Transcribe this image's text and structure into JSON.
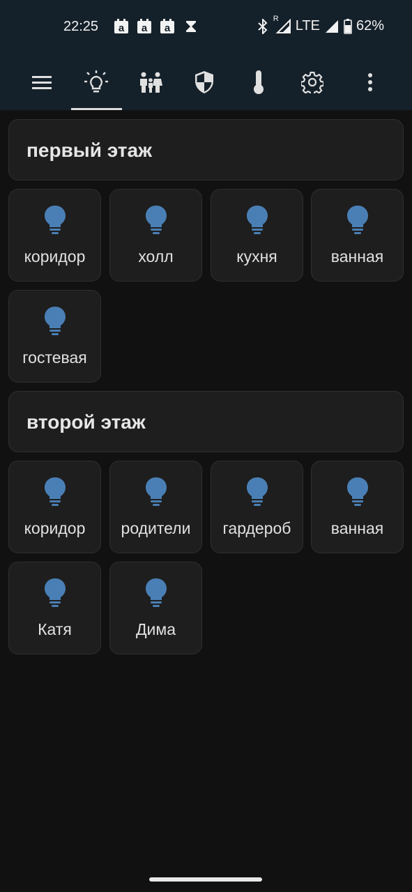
{
  "status_bar": {
    "time": "22:25",
    "notification_icons": [
      "amazon-icon",
      "amazon-icon",
      "amazon-icon",
      "hourglass-icon"
    ],
    "roaming_indicator": "R",
    "network": "LTE",
    "battery": "62%"
  },
  "tabs": [
    {
      "icon": "menu-icon"
    },
    {
      "icon": "lightbulb-icon",
      "selected": true
    },
    {
      "icon": "family-icon"
    },
    {
      "icon": "security-shield-icon"
    },
    {
      "icon": "thermometer-icon"
    },
    {
      "icon": "gear-icon"
    },
    {
      "icon": "more-vert-icon"
    }
  ],
  "colors": {
    "accent": "#4a7fb5",
    "background": "#111111",
    "card": "#1e1e1e",
    "app_bar": "#15212a"
  },
  "floors": [
    {
      "title": "первый этаж",
      "rooms": [
        {
          "label": "коридор",
          "icon": "lightbulb-icon"
        },
        {
          "label": "холл",
          "icon": "lightbulb-icon"
        },
        {
          "label": "кухня",
          "icon": "lightbulb-icon"
        },
        {
          "label": "ванная",
          "icon": "lightbulb-icon"
        },
        {
          "label": "гостевая",
          "icon": "lightbulb-icon"
        }
      ]
    },
    {
      "title": "второй этаж",
      "rooms": [
        {
          "label": "коридор",
          "icon": "lightbulb-icon"
        },
        {
          "label": "родители",
          "icon": "lightbulb-icon"
        },
        {
          "label": "гардероб",
          "icon": "lightbulb-icon"
        },
        {
          "label": "ванная",
          "icon": "lightbulb-icon"
        },
        {
          "label": "Катя",
          "icon": "lightbulb-icon"
        },
        {
          "label": "Дима",
          "icon": "lightbulb-icon"
        }
      ]
    }
  ]
}
